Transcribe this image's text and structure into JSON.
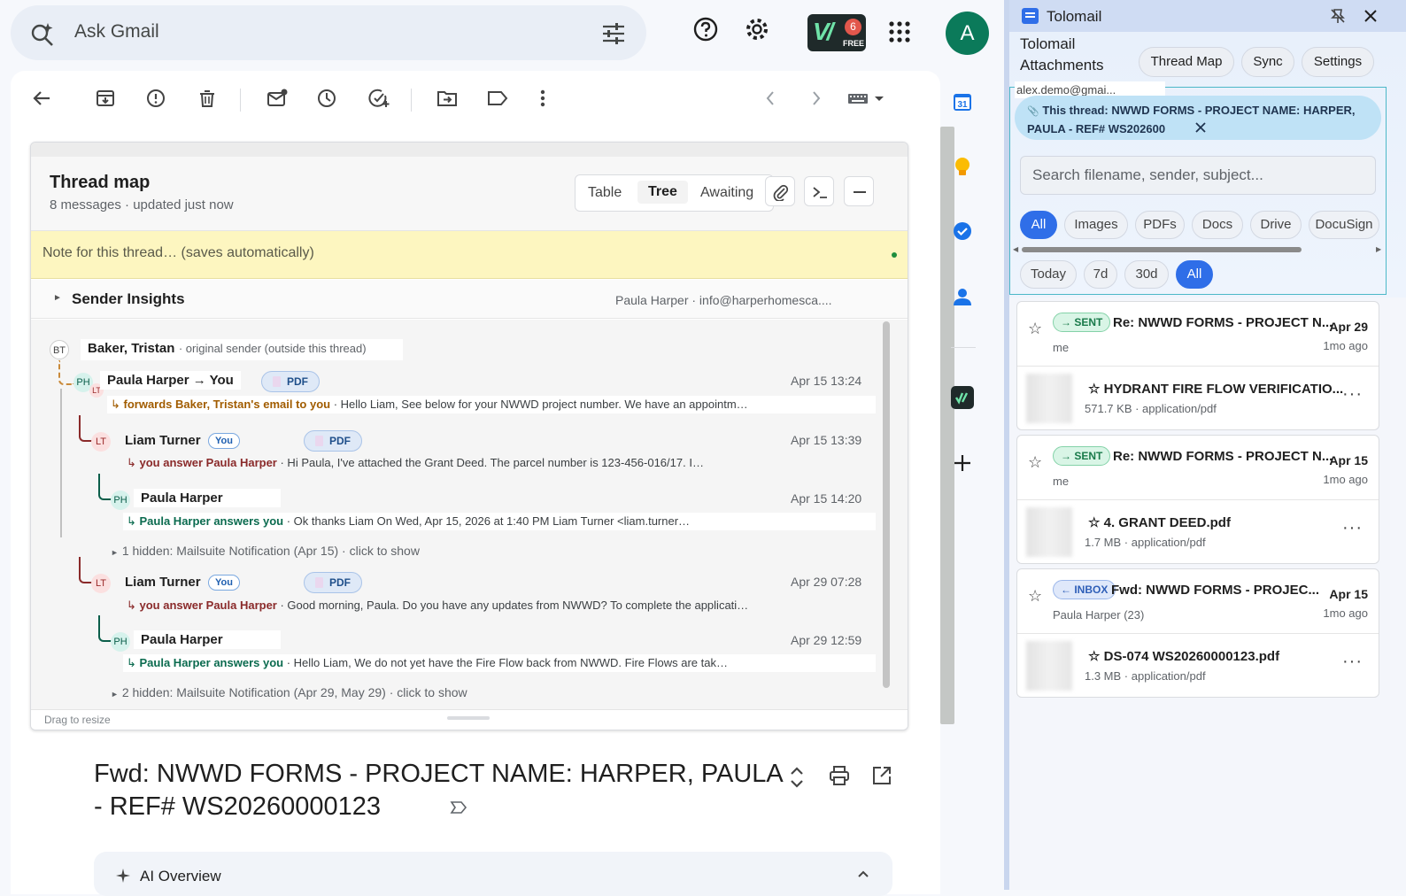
{
  "search": {
    "placeholder": "Ask Gmail"
  },
  "badge": {
    "count": "6",
    "label": "FREE",
    "logo": "V/"
  },
  "avatar": {
    "initial": "A",
    "color": "#0b7a5a"
  },
  "threadmap": {
    "title": "Thread map",
    "subtitle": "8 messages · updated just now",
    "views": [
      "Table",
      "Tree",
      "Awaiting"
    ],
    "active_view": "Tree",
    "note_placeholder": "Note for this thread… (saves automatically)",
    "sender_insights": {
      "label": "Sender Insights",
      "who": "Paula Harper · info@harperhomesca...."
    },
    "root": {
      "initials": "BT",
      "name": "Baker, Tristan",
      "meta": "· original sender (outside this thread)"
    },
    "messages": [
      {
        "initials": "PH",
        "sub": "LT",
        "name": "Paula Harper → You",
        "pdf": "PDF",
        "date": "Apr 15 13:24",
        "action": "forwards Baker, Tristan's email to you",
        "snippet": "· Hello Liam, See below for your NWWD project number. We have an appointm…"
      },
      {
        "initials": "LT",
        "name": "Liam Turner",
        "you": "You",
        "pdf": "PDF",
        "date": "Apr 15 13:39",
        "action": "you answer Paula Harper",
        "snippet": "· Hi Paula, I've attached the Grant Deed. The parcel number is 123-456-016/17. I…"
      },
      {
        "initials": "PH",
        "name": "Paula Harper",
        "date": "Apr 15 14:20",
        "action": "Paula Harper answers you",
        "snippet": "· Ok thanks Liam On Wed, Apr 15, 2026 at 1:40 PM Liam Turner <liam.turner…"
      },
      {
        "initials": "LT",
        "name": "Liam Turner",
        "you": "You",
        "pdf": "PDF",
        "date": "Apr 29 07:28",
        "action": "you answer Paula Harper",
        "snippet": "· Good morning, Paula. Do you have any updates from NWWD? To complete the applicati…"
      },
      {
        "initials": "PH",
        "name": "Paula Harper",
        "date": "Apr 29 12:59",
        "action": "Paula Harper answers you",
        "snippet": "· Hello Liam, We do not yet have the Fire Flow back from NWWD. Fire Flows are tak…"
      }
    ],
    "hidden1": "1 hidden: Mailsuite Notification (Apr 15) · click to show",
    "hidden2": "2 hidden: Mailsuite Notification (Apr 29, May 29) · click to show",
    "drag": "Drag to resize"
  },
  "email": {
    "subject_line1": "Fwd: NWWD FORMS - PROJECT NAME: HARPER, PAULA",
    "subject_line2": "- REF# WS20260000123",
    "ai_overview": "AI Overview"
  },
  "tolomail": {
    "app": "Tolomail",
    "title": "Tolomail Attachments",
    "buttons": [
      "Thread Map",
      "Sync",
      "Settings"
    ],
    "account": "alex.demo@gmai...",
    "thread_pill": "This thread: NWWD FORMS - PROJECT NAME: HARPER, PAULA - REF# WS202600",
    "search_placeholder": "Search filename, sender, subject...",
    "filters": [
      "All",
      "Images",
      "PDFs",
      "Docs",
      "Drive",
      "DocuSign"
    ],
    "ranges": [
      "Today",
      "7d",
      "30d",
      "All"
    ],
    "groups": [
      {
        "tag": "→ SENT",
        "tagtype": "sent",
        "subject": "Re: NWWD FORMS - PROJECT N...",
        "date": "Apr 29",
        "ago": "1mo ago",
        "from": "me",
        "file": "HYDRANT FIRE FLOW VERIFICATIO...",
        "meta": "571.7 KB · application/pdf"
      },
      {
        "tag": "→ SENT",
        "tagtype": "sent",
        "subject": "Re: NWWD FORMS - PROJECT N...",
        "date": "Apr 15",
        "ago": "1mo ago",
        "from": "me",
        "file": "4. GRANT DEED.pdf",
        "meta": "1.7 MB · application/pdf"
      },
      {
        "tag": "← INBOX",
        "tagtype": "inbox",
        "subject": "Fwd: NWWD FORMS - PROJEC...",
        "date": "Apr 15",
        "ago": "1mo ago",
        "from": "Paula Harper (23)",
        "file": "DS-074 WS20260000123.pdf",
        "meta": "1.3 MB · application/pdf"
      }
    ]
  }
}
